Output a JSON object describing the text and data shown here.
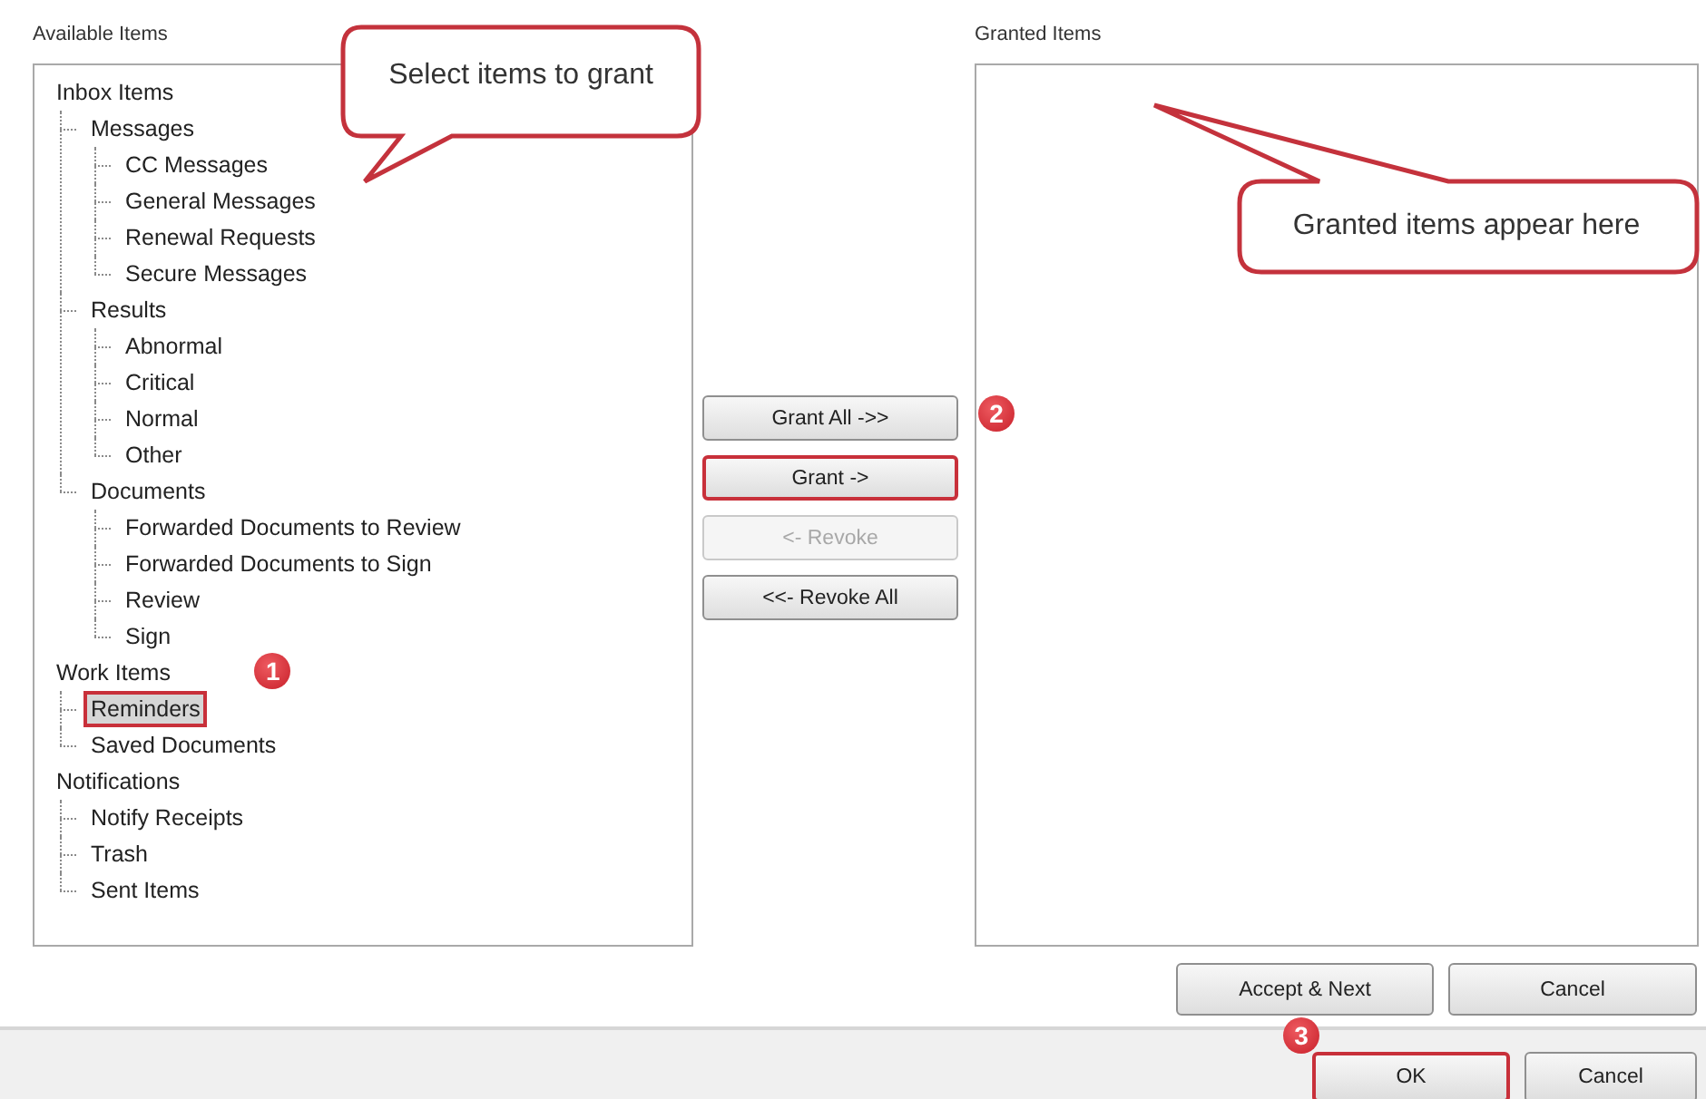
{
  "available": {
    "label": "Available Items",
    "tree": [
      {
        "label": "Inbox Items",
        "selected": false,
        "highlighted": false,
        "children": [
          {
            "label": "Messages",
            "selected": false,
            "highlighted": false,
            "children": [
              {
                "label": "CC Messages",
                "selected": false,
                "highlighted": false
              },
              {
                "label": "General Messages",
                "selected": false,
                "highlighted": false
              },
              {
                "label": "Renewal Requests",
                "selected": false,
                "highlighted": false
              },
              {
                "label": "Secure Messages",
                "selected": false,
                "highlighted": false
              }
            ]
          },
          {
            "label": "Results",
            "selected": false,
            "highlighted": false,
            "children": [
              {
                "label": "Abnormal",
                "selected": false,
                "highlighted": false
              },
              {
                "label": "Critical",
                "selected": false,
                "highlighted": false
              },
              {
                "label": "Normal",
                "selected": false,
                "highlighted": false
              },
              {
                "label": "Other",
                "selected": false,
                "highlighted": false
              }
            ]
          },
          {
            "label": "Documents",
            "selected": false,
            "highlighted": false,
            "children": [
              {
                "label": "Forwarded Documents to Review",
                "selected": false,
                "highlighted": false
              },
              {
                "label": "Forwarded Documents to Sign",
                "selected": false,
                "highlighted": false
              },
              {
                "label": "Review",
                "selected": false,
                "highlighted": false
              },
              {
                "label": "Sign",
                "selected": false,
                "highlighted": false
              }
            ]
          }
        ]
      },
      {
        "label": "Work Items",
        "selected": false,
        "highlighted": false,
        "children": [
          {
            "label": "Reminders",
            "selected": true,
            "highlighted": true,
            "badge": "1"
          },
          {
            "label": "Saved Documents",
            "selected": false,
            "highlighted": false
          }
        ]
      },
      {
        "label": "Notifications",
        "selected": false,
        "highlighted": false,
        "children": [
          {
            "label": "Notify Receipts",
            "selected": false,
            "highlighted": false
          },
          {
            "label": "Trash",
            "selected": false,
            "highlighted": false
          },
          {
            "label": "Sent Items",
            "selected": false,
            "highlighted": false
          }
        ]
      }
    ]
  },
  "transfer_buttons": [
    {
      "label": "Grant All ->>",
      "disabled": false,
      "highlighted": false
    },
    {
      "label": "Grant ->",
      "disabled": false,
      "highlighted": true,
      "badge": "2"
    },
    {
      "label": "<- Revoke",
      "disabled": true,
      "highlighted": false
    },
    {
      "label": "<<- Revoke All",
      "disabled": false,
      "highlighted": false
    }
  ],
  "granted": {
    "label": "Granted Items"
  },
  "callouts": [
    {
      "text": "Select items to grant"
    },
    {
      "text": "Granted items appear here"
    }
  ],
  "step_buttons": [
    {
      "label": "Accept & Next",
      "highlighted": false
    },
    {
      "label": "Cancel",
      "highlighted": false
    }
  ],
  "dialog_buttons": [
    {
      "label": "OK",
      "highlighted": true,
      "badge": "3"
    },
    {
      "label": "Cancel",
      "highlighted": false
    }
  ]
}
